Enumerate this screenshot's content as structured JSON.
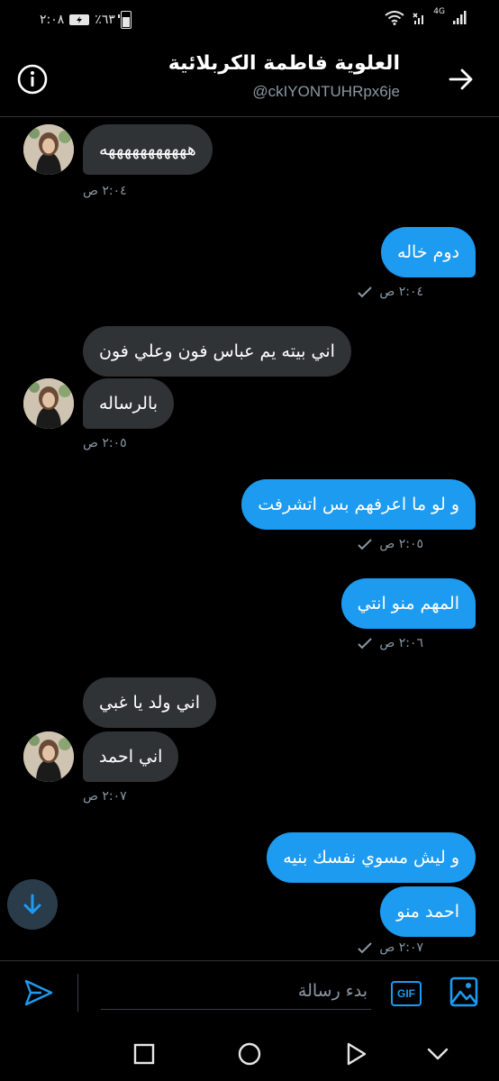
{
  "status_bar": {
    "time": "٢:٠٨",
    "battery": "٪٦٣",
    "battery_level": 0.63,
    "network": "4G"
  },
  "header": {
    "title": "العلوية فاطمة الكربلائية",
    "handle": "@ckIYONTUHRpx6je",
    "info_icon": "info-icon",
    "back_icon": "arrow-right-icon"
  },
  "messages": [
    {
      "text": "هههههههههههه",
      "dir": "in"
    },
    {
      "text": "دوم خاله",
      "dir": "out"
    },
    {
      "text": "اني بيته يم عباس فون وعلي فون",
      "dir": "in"
    },
    {
      "text": "بالرساله",
      "dir": "in"
    },
    {
      "text": "و لو ما اعرفهم بس اتشرفت",
      "dir": "out"
    },
    {
      "text": "المهم منو انتي",
      "dir": "out"
    },
    {
      "text": "اني ولد يا غبي",
      "dir": "in"
    },
    {
      "text": "اني احمد",
      "dir": "in"
    },
    {
      "text": "و ليش مسوي نفسك بنيه",
      "dir": "out"
    },
    {
      "text": "احمد منو",
      "dir": "out"
    }
  ],
  "timestamps": [
    "٢:٠٤ ص",
    "٢:٠٤ ص",
    "٢:٠٥ ص",
    "٢:٠٥ ص",
    "٢:٠٦ ص",
    "٢:٠٧ ص",
    "٢:٠٧ ص"
  ],
  "composer": {
    "placeholder": "بدء رسالة",
    "gif_label": "GIF",
    "send_icon": "send-icon",
    "image_icon": "image-icon"
  },
  "scroll_icon": "arrow-down-icon",
  "navbar": {
    "icons": [
      "chevron-down-icon",
      "back-triangle-icon",
      "home-circle-icon",
      "recents-square-icon"
    ]
  },
  "colors": {
    "accent": "#1d9bf0",
    "incoming_bubble": "#2f3336",
    "background": "#000000",
    "muted": "#8b98a5"
  }
}
